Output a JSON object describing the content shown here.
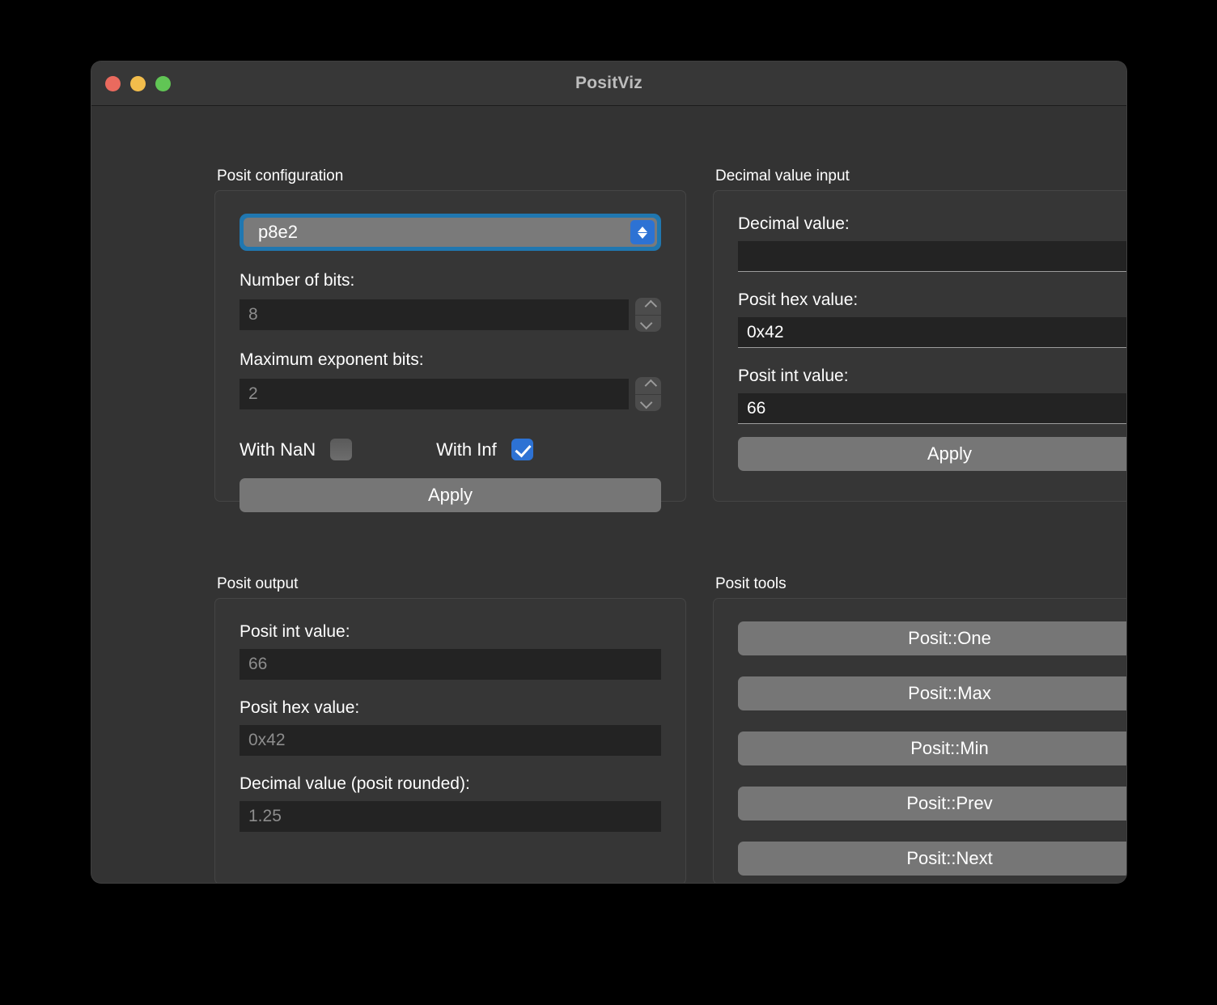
{
  "window": {
    "title": "PositViz",
    "traffic_lights": [
      {
        "name": "close",
        "color": "#ea6a5e"
      },
      {
        "name": "minimize",
        "color": "#f2bd4c"
      },
      {
        "name": "maximize",
        "color": "#61c555"
      }
    ]
  },
  "posit_configuration": {
    "group_label": "Posit configuration",
    "preset": {
      "selected": "p8e2",
      "options": [
        "p8e2"
      ]
    },
    "number_of_bits": {
      "label": "Number of bits:",
      "value": "8"
    },
    "maximum_exponent_bits": {
      "label": "Maximum exponent bits:",
      "value": "2"
    },
    "with_nan": {
      "label": "With NaN",
      "checked": false
    },
    "with_inf": {
      "label": "With Inf",
      "checked": true
    },
    "apply_label": "Apply"
  },
  "decimal_value_input": {
    "group_label": "Decimal value input",
    "decimal_value": {
      "label": "Decimal value:",
      "value": ""
    },
    "posit_hex_value": {
      "label": "Posit hex value:",
      "value": "0x42"
    },
    "posit_int_value": {
      "label": "Posit int value:",
      "value": "66"
    },
    "apply_label": "Apply"
  },
  "posit_output": {
    "group_label": "Posit output",
    "posit_int_value": {
      "label": "Posit int value:",
      "value": "66"
    },
    "posit_hex_value": {
      "label": "Posit hex value:",
      "value": "0x42"
    },
    "decimal_value_rounded": {
      "label": "Decimal value (posit rounded):",
      "value": "1.25"
    }
  },
  "posit_tools": {
    "group_label": "Posit tools",
    "buttons": [
      {
        "label": "Posit::One"
      },
      {
        "label": "Posit::Max"
      },
      {
        "label": "Posit::Min"
      },
      {
        "label": "Posit::Prev"
      },
      {
        "label": "Posit::Next"
      }
    ]
  },
  "colors": {
    "window_background": "#333333",
    "titlebar": "#373737",
    "group_background": "#363636",
    "input_background": "#232323",
    "button": "#767676",
    "accent_blue": "#2d72d4",
    "focus_ring": "#2077b0",
    "disabled_text": "#8d8d8d"
  }
}
